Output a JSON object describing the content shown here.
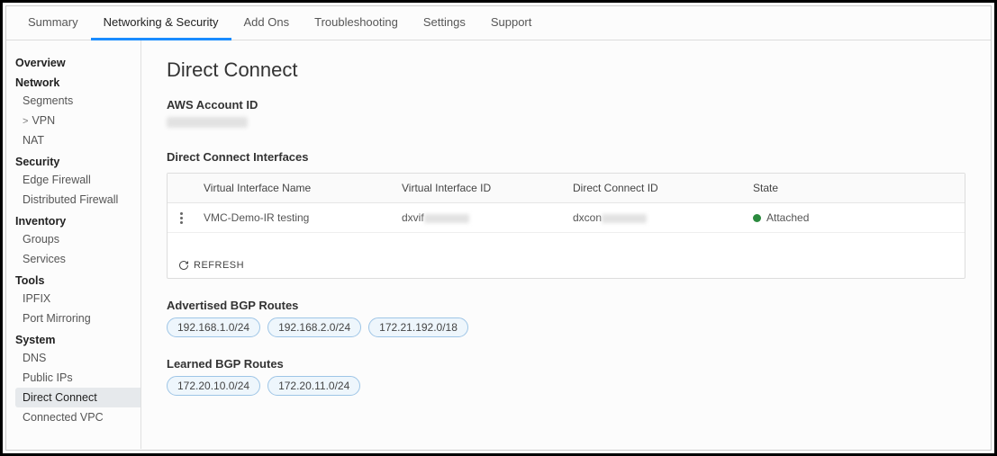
{
  "tabs": {
    "items": [
      {
        "label": "Summary",
        "active": false
      },
      {
        "label": "Networking & Security",
        "active": true
      },
      {
        "label": "Add Ons",
        "active": false
      },
      {
        "label": "Troubleshooting",
        "active": false
      },
      {
        "label": "Settings",
        "active": false
      },
      {
        "label": "Support",
        "active": false
      }
    ]
  },
  "sidebar": {
    "sections": [
      {
        "heading": "Overview",
        "items": []
      },
      {
        "heading": "Network",
        "items": [
          {
            "label": "Segments"
          },
          {
            "label": "VPN",
            "expandable": true
          },
          {
            "label": "NAT"
          }
        ]
      },
      {
        "heading": "Security",
        "items": [
          {
            "label": "Edge Firewall"
          },
          {
            "label": "Distributed Firewall"
          }
        ]
      },
      {
        "heading": "Inventory",
        "items": [
          {
            "label": "Groups"
          },
          {
            "label": "Services"
          }
        ]
      },
      {
        "heading": "Tools",
        "items": [
          {
            "label": "IPFIX"
          },
          {
            "label": "Port Mirroring"
          }
        ]
      },
      {
        "heading": "System",
        "items": [
          {
            "label": "DNS"
          },
          {
            "label": "Public IPs"
          },
          {
            "label": "Direct Connect",
            "active": true
          },
          {
            "label": "Connected VPC"
          }
        ]
      }
    ]
  },
  "main": {
    "page_title": "Direct Connect",
    "aws_account_label": "AWS Account ID",
    "aws_account_value": "",
    "interfaces_heading": "Direct Connect Interfaces",
    "table": {
      "headers": {
        "name": "Virtual Interface Name",
        "vid": "Virtual Interface ID",
        "dcid": "Direct Connect ID",
        "state": "State"
      },
      "rows": [
        {
          "name": "VMC-Demo-IR testing",
          "vid_prefix": "dxvif",
          "dcid_prefix": "dxcon",
          "state": "Attached",
          "state_color": "#2b8a3e"
        }
      ],
      "refresh_label": "REFRESH"
    },
    "advertised_heading": "Advertised BGP Routes",
    "advertised_routes": [
      "192.168.1.0/24",
      "192.168.2.0/24",
      "172.21.192.0/18"
    ],
    "learned_heading": "Learned BGP Routes",
    "learned_routes": [
      "172.20.10.0/24",
      "172.20.11.0/24"
    ]
  }
}
